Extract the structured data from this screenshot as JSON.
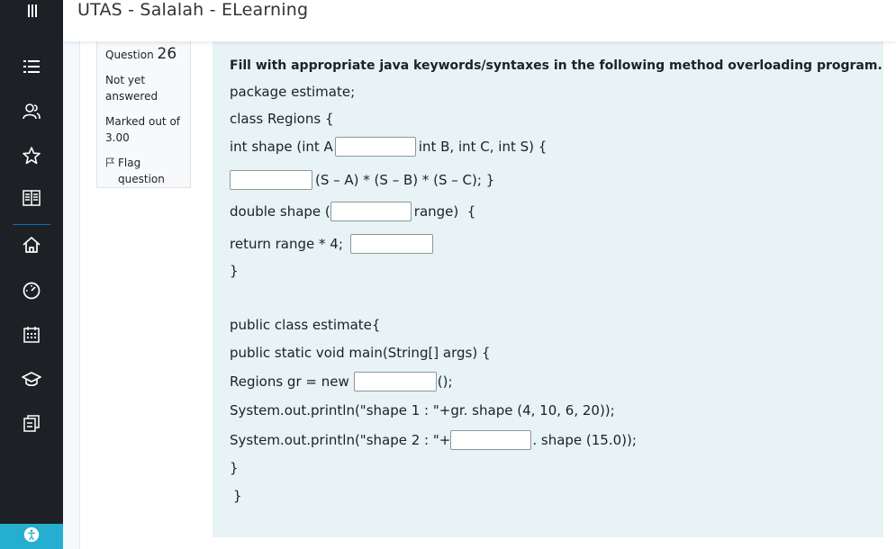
{
  "header": {
    "title": "UTAS - Salalah - ELearning"
  },
  "sidebar": {
    "icons": [
      "menu-icon",
      "list-icon",
      "users-icon",
      "star-icon",
      "book-icon",
      "home-icon",
      "dashboard-icon",
      "calendar-icon",
      "graduation-cap-icon",
      "tasks-icon",
      "accessibility-icon"
    ]
  },
  "question_info": {
    "label": "Question",
    "number": "26",
    "state_line1": "Not yet",
    "state_line2": "answered",
    "mark_line1": "Marked out of",
    "mark_line2": "3.00",
    "flag_line1": "Flag",
    "flag_line2": "question"
  },
  "question": {
    "instruction": "Fill  with appropriate java keywords/syntaxes in the following method overloading program.",
    "l_package": "package estimate;",
    "l_class": "class Regions {",
    "l_int_a": "int shape (int A",
    "l_int_b": "int B, int C, int S) {",
    "l_calc": "(S – A) * (S – B) * (S – C); }",
    "l_double": "double shape (",
    "l_range": "range)  {",
    "l_return": "return range * 4;",
    "l_close1": "}",
    "l_public_class": "public class  estimate{",
    "l_main": "public static void main(String[] args) {",
    "l_regions": "Regions gr = new",
    "l_regions_end": "();",
    "l_print1": "System.out.println(\"shape 1 : \"+gr. shape (4, 10, 6, 20));",
    "l_print2": "System.out.println(\"shape 2 : \"+",
    "l_print2_end": ". shape (15.0));",
    "l_close2": "}",
    "l_close3": "}"
  },
  "colors": {
    "sidebar_bg": "#1d2125",
    "panel_bg": "#e7f3f5",
    "accent": "#25aecf"
  }
}
